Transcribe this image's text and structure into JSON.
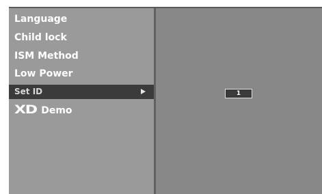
{
  "menu": {
    "items": [
      {
        "label": "Language"
      },
      {
        "label": "Child lock"
      },
      {
        "label": "ISM Method"
      },
      {
        "label": "Low Power"
      },
      {
        "label": "Set ID",
        "selected": true
      },
      {
        "logo": "XD",
        "label": "Demo"
      }
    ]
  },
  "set_id": {
    "value": "1"
  },
  "icons": {
    "submenu_arrow": "arrow-right-icon"
  },
  "colors": {
    "menu_background": "#9a9a9a",
    "selected_background": "#3b3b3b",
    "panel_background": "#888888",
    "text": "#ffffff"
  }
}
